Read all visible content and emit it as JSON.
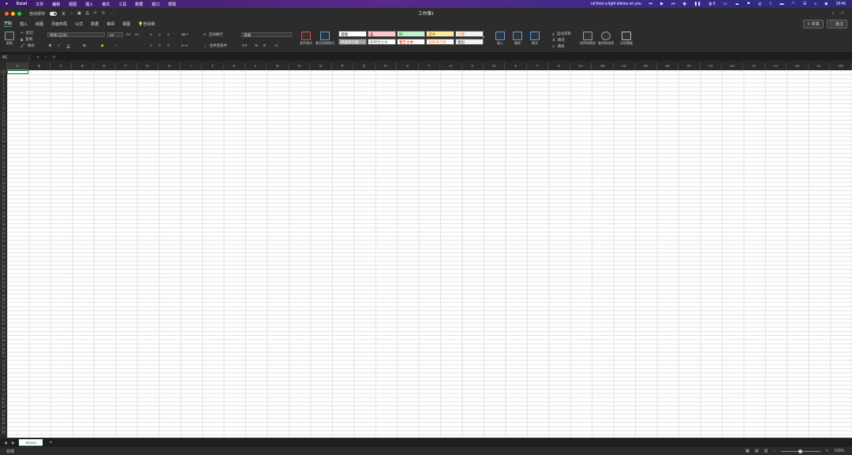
{
  "menubar": {
    "app_name": "Excel",
    "items": [
      "文件",
      "编辑",
      "视图",
      "插入",
      "格式",
      "工具",
      "数据",
      "窗口",
      "帮助"
    ],
    "now_playing": "nd then a light shines on you",
    "clock": "18:46",
    "badge_count": "6"
  },
  "titlebar": {
    "autosave_label": "自动保存",
    "autosave_state": "关",
    "title": "工作簿1"
  },
  "tabs": {
    "items": [
      "开始",
      "插入",
      "绘图",
      "页面布局",
      "公式",
      "数据",
      "审阅",
      "视图"
    ],
    "tell_me": "告诉我",
    "share": "共享",
    "comments": "批注"
  },
  "ribbon": {
    "paste": "粘贴",
    "cut": "剪切",
    "copy": "复制",
    "format_painter": "格式",
    "font_name": "等线 (正文)",
    "font_size": "12",
    "bold": "B",
    "italic": "I",
    "underline": "U",
    "wrap_text": "自动换行",
    "merge_center": "合并后居中",
    "number_format": "常规",
    "conditional_format": "条件格式",
    "format_as_table": "套用表格格式",
    "cell_styles": [
      {
        "label": "常规",
        "bg": "#ffffff",
        "fg": "#000000"
      },
      {
        "label": "差",
        "bg": "#ffc7ce",
        "fg": "#9c0006"
      },
      {
        "label": "好",
        "bg": "#c6efce",
        "fg": "#006100"
      },
      {
        "label": "适中",
        "bg": "#ffeb9c",
        "fg": "#9c5700"
      },
      {
        "label": "计算",
        "bg": "#f2f2f2",
        "fg": "#fa7d00"
      },
      {
        "label": "检查单元格",
        "bg": "#a5a5a5",
        "fg": "#ffffff"
      },
      {
        "label": "解释性文本",
        "bg": "#ffffff",
        "fg": "#7f7f7f"
      },
      {
        "label": "警告文本",
        "bg": "#ffffff",
        "fg": "#ff0000"
      },
      {
        "label": "链接单元格",
        "bg": "#ffffff",
        "fg": "#fa7d00"
      },
      {
        "label": "输出",
        "bg": "#f2f2f2",
        "fg": "#3f3f3f"
      }
    ],
    "insert": "插入",
    "delete": "删除",
    "format": "格式",
    "autosum": "自动求和",
    "fill": "填充",
    "clear": "清除",
    "sort_filter": "排序和筛选",
    "find_select": "查找和选择",
    "analyze": "分析数据"
  },
  "formula_bar": {
    "name_box": "A1",
    "fx": "fx"
  },
  "grid": {
    "columns": [
      "A",
      "B",
      "C",
      "D",
      "E",
      "F",
      "G",
      "H",
      "I",
      "J",
      "K",
      "L",
      "M",
      "N",
      "O",
      "P",
      "Q",
      "R",
      "S",
      "T",
      "U",
      "V",
      "W",
      "X",
      "Y",
      "Z",
      "AA",
      "AB",
      "AC",
      "AD",
      "AE",
      "AF",
      "AG",
      "AH",
      "AI",
      "AJ",
      "AK",
      "AL",
      "AM"
    ],
    "row_count": 88,
    "active_cell": "A1"
  },
  "sheets": {
    "tabs": [
      "Sheet1"
    ],
    "active": "Sheet1"
  },
  "status": {
    "state": "就绪",
    "zoom": "100%"
  },
  "colors": {
    "accent": "#217346",
    "tab_underline": "#2fa36b"
  }
}
